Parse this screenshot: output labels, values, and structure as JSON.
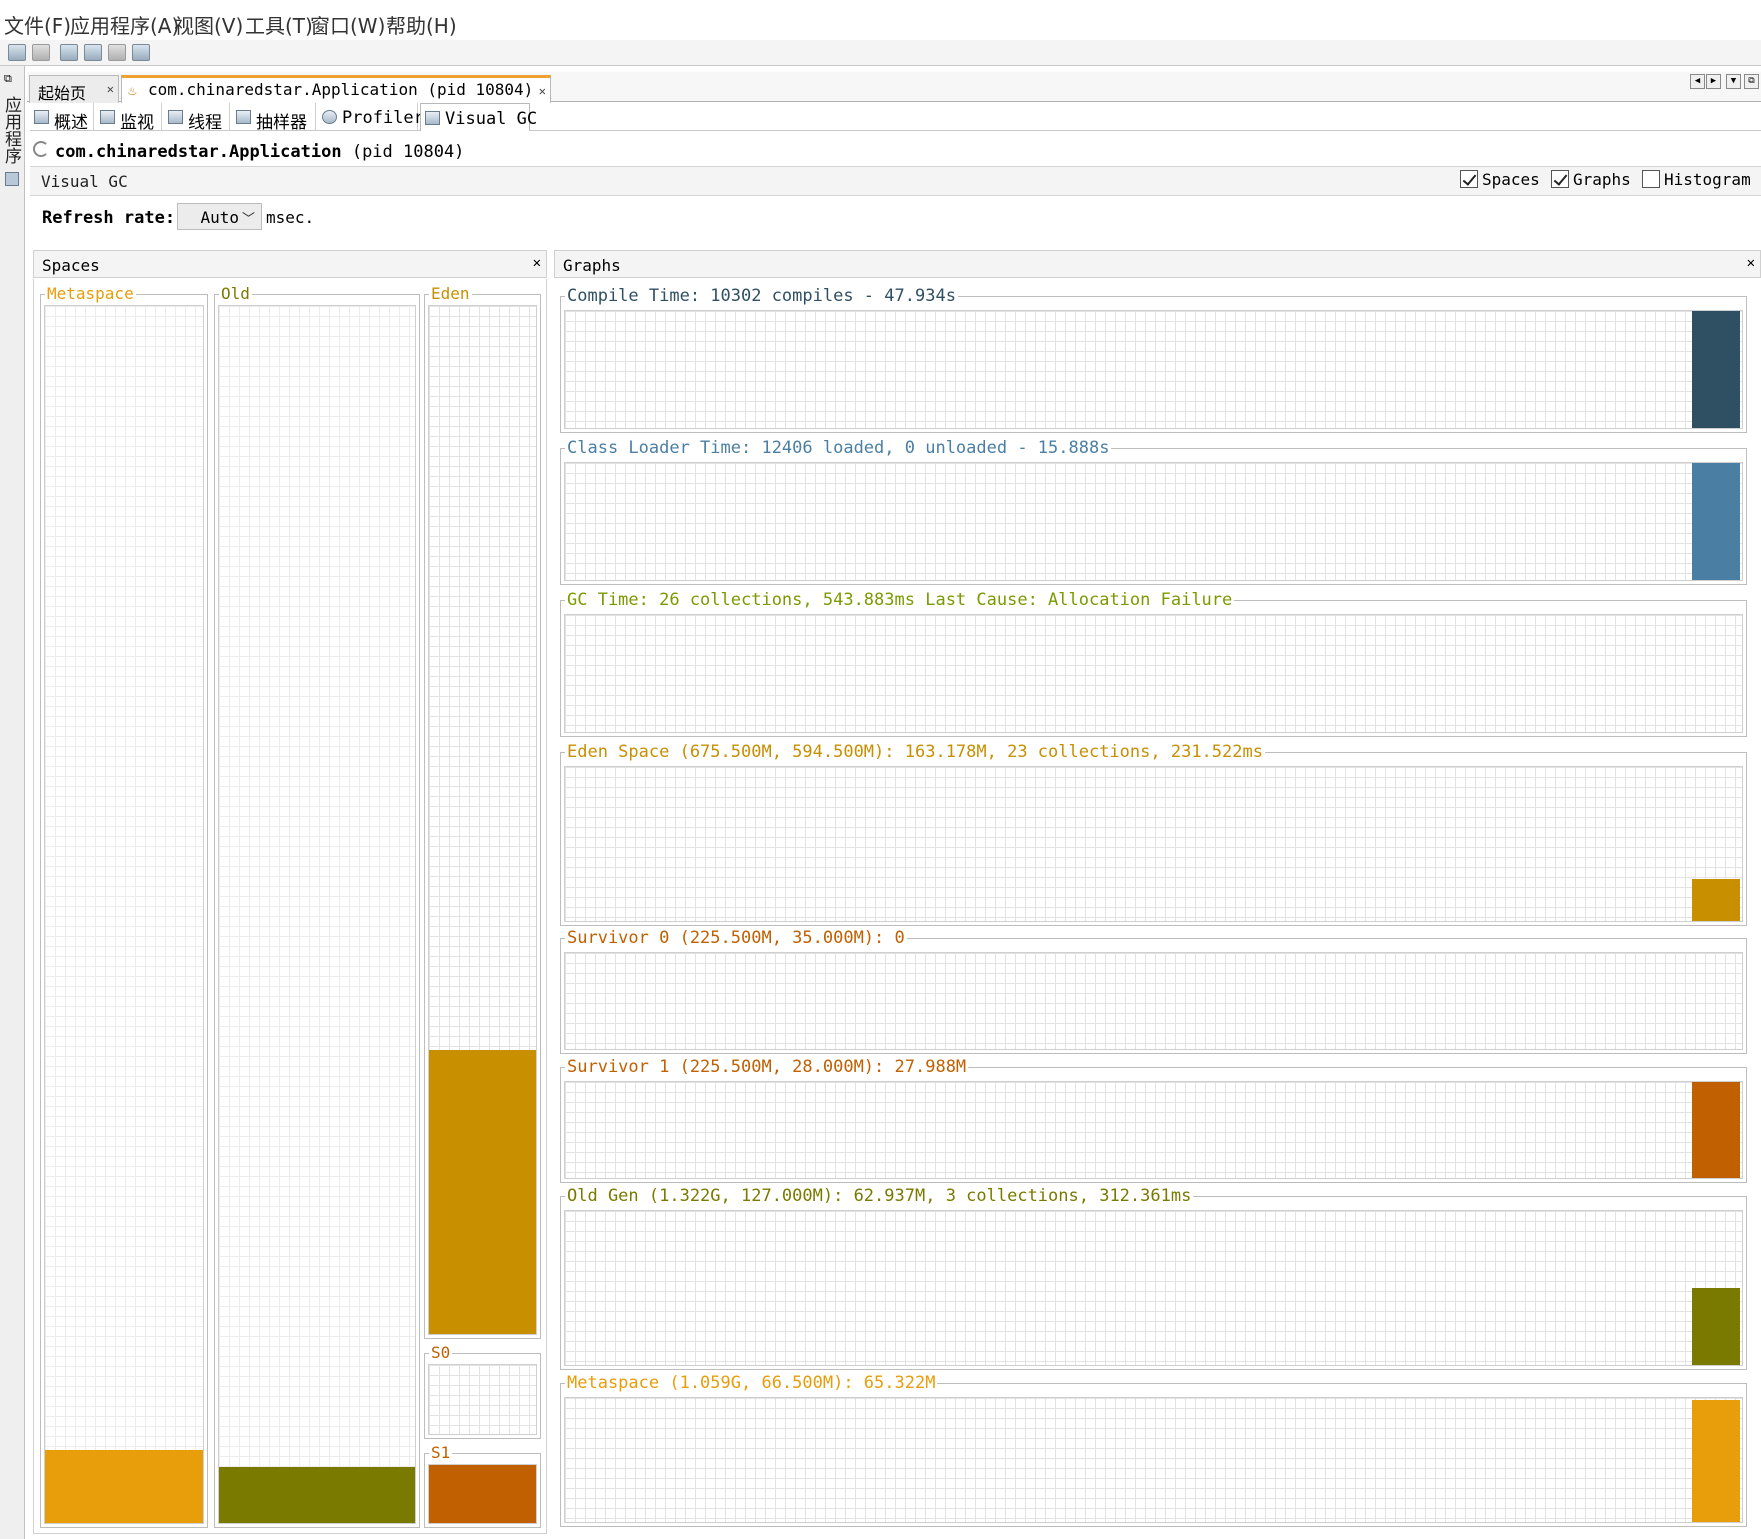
{
  "menubar": {
    "items": [
      "文件(F)",
      "应用程序(A)",
      "视图(V)",
      "工具(T)",
      "窗口(W)",
      "帮助(H)"
    ]
  },
  "left_strip": {
    "label": "应用程序"
  },
  "doc_tabs": [
    {
      "label": "起始页"
    },
    {
      "label": "com.chinaredstar.Application (pid 10804)"
    }
  ],
  "sub_tabs": [
    "概述",
    "监视",
    "线程",
    "抽样器",
    "Profiler",
    "Visual GC"
  ],
  "app_header": {
    "name": "com.chinaredstar.Application",
    "pid": "(pid 10804)"
  },
  "visual_gc": {
    "title": "Visual GC",
    "options": [
      {
        "label": "Spaces",
        "checked": true
      },
      {
        "label": "Graphs",
        "checked": true
      },
      {
        "label": "Histogram",
        "checked": false
      }
    ],
    "refresh_label": "Refresh rate:",
    "refresh_value": "Auto",
    "refresh_unit": "msec."
  },
  "spaces": {
    "title": "Spaces",
    "items": [
      {
        "name": "Metaspace",
        "used_fraction": 0.06,
        "color": "#e89d0a",
        "title_color": "#e89d0a"
      },
      {
        "name": "Old",
        "used_fraction": 0.046,
        "color": "#7a7a00",
        "title_color": "#7a7a00"
      },
      {
        "name": "Eden",
        "used_fraction": 0.276,
        "color": "#c88f00",
        "title_color": "#c88f00"
      },
      {
        "name": "S0",
        "used_fraction": 0.0,
        "color": "#c06000",
        "title_color": "#c06000"
      },
      {
        "name": "S1",
        "used_fraction": 1.0,
        "color": "#c06000",
        "title_color": "#c06000"
      }
    ]
  },
  "graphs": {
    "title": "Graphs",
    "items": [
      {
        "label": "Compile Time: 10302 compiles - 47.934s",
        "color": "#2f4f63",
        "title_color": "#2f4f63",
        "level": 1.0
      },
      {
        "label": "Class Loader Time: 12406 loaded, 0 unloaded - 15.888s",
        "color": "#4a7fa3",
        "title_color": "#4a7fa3",
        "level": 1.0
      },
      {
        "label": "GC Time: 26 collections, 543.883ms Last Cause: Allocation Failure",
        "color": "#7a9b00",
        "title_color": "#7a9b00",
        "level": 0.0
      },
      {
        "label": "Eden Space (675.500M, 594.500M): 163.178M, 23 collections, 231.522ms",
        "color": "#c88f00",
        "title_color": "#c88f00",
        "level": 0.27
      },
      {
        "label": "Survivor 0 (225.500M, 35.000M): 0",
        "color": "#c06000",
        "title_color": "#c06000",
        "level": 0.0
      },
      {
        "label": "Survivor 1 (225.500M, 28.000M): 27.988M",
        "color": "#c06000",
        "title_color": "#c06000",
        "level": 1.0
      },
      {
        "label": "Old Gen (1.322G, 127.000M): 62.937M, 3 collections, 312.361ms",
        "color": "#7a7a00",
        "title_color": "#7a7a00",
        "level": 0.5
      },
      {
        "label": "Metaspace (1.059G, 66.500M): 65.322M",
        "color": "#e89d0a",
        "title_color": "#e89d0a",
        "level": 0.98
      }
    ]
  }
}
